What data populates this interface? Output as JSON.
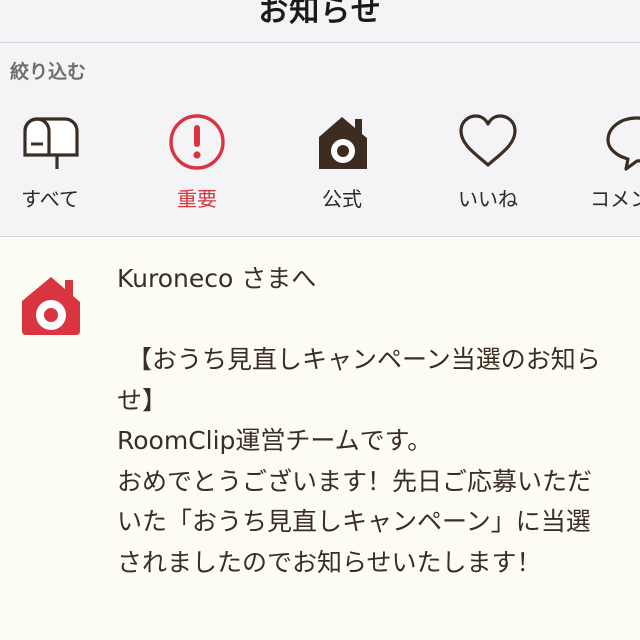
{
  "header": {
    "title": "お知らせ"
  },
  "filter": {
    "label": "絞り込む",
    "chips": [
      {
        "label": "すべて",
        "icon": "mailbox-icon"
      },
      {
        "label": "重要",
        "icon": "exclamation-icon",
        "color": "#d9343f"
      },
      {
        "label": "公式",
        "icon": "house-icon"
      },
      {
        "label": "いいね",
        "icon": "heart-icon"
      },
      {
        "label": "コメント",
        "icon": "speech-bubble-icon"
      }
    ]
  },
  "feed": {
    "items": [
      {
        "avatar_icon": "roomclip-house-icon",
        "brand_color": "#d9343f",
        "lines": [
          "Kuroneco さまへ",
          "",
          "【おうち見直しキャンペーン当選のお知ら",
          "せ】",
          "RoomClip運営チームです。",
          "おめでとうございます！先日ご応募いただ",
          "いた「おうち見直しキャンペーン」に当選",
          "されましたのでお知らせいたします！"
        ]
      }
    ]
  }
}
